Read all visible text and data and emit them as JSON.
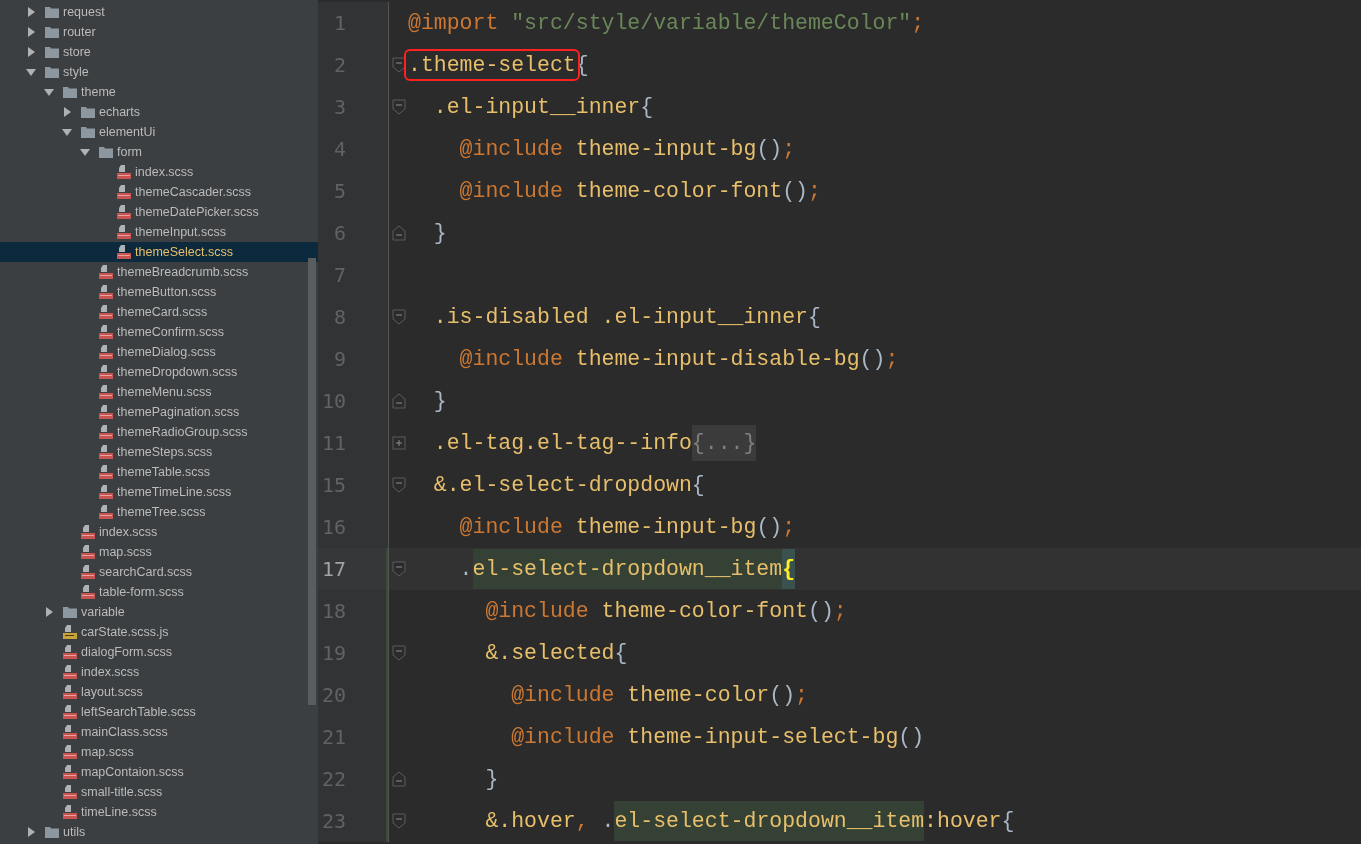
{
  "project_tree": [
    {
      "name": "request",
      "kind": "folder",
      "expanded": false,
      "selected": false
    },
    {
      "name": "router",
      "kind": "folder",
      "expanded": false,
      "selected": false
    },
    {
      "name": "store",
      "kind": "folder",
      "expanded": false,
      "selected": false
    },
    {
      "name": "style",
      "kind": "folder",
      "expanded": true,
      "selected": false,
      "children": [
        {
          "name": "theme",
          "kind": "folder",
          "expanded": true,
          "selected": false,
          "children": [
            {
              "name": "echarts",
              "kind": "folder",
              "expanded": false,
              "selected": false
            },
            {
              "name": "elementUi",
              "kind": "folder",
              "expanded": true,
              "selected": false,
              "children": [
                {
                  "name": "form",
                  "kind": "folder",
                  "expanded": true,
                  "selected": false,
                  "children": [
                    {
                      "name": "index.scss",
                      "kind": "sass",
                      "selected": false
                    },
                    {
                      "name": "themeCascader.scss",
                      "kind": "sass",
                      "selected": false
                    },
                    {
                      "name": "themeDatePicker.scss",
                      "kind": "sass",
                      "selected": false
                    },
                    {
                      "name": "themeInput.scss",
                      "kind": "sass",
                      "selected": false
                    },
                    {
                      "name": "themeSelect.scss",
                      "kind": "sass",
                      "selected": true
                    }
                  ]
                },
                {
                  "name": "themeBreadcrumb.scss",
                  "kind": "sass",
                  "selected": false
                },
                {
                  "name": "themeButton.scss",
                  "kind": "sass",
                  "selected": false
                },
                {
                  "name": "themeCard.scss",
                  "kind": "sass",
                  "selected": false
                },
                {
                  "name": "themeConfirm.scss",
                  "kind": "sass",
                  "selected": false
                },
                {
                  "name": "themeDialog.scss",
                  "kind": "sass",
                  "selected": false
                },
                {
                  "name": "themeDropdown.scss",
                  "kind": "sass",
                  "selected": false
                },
                {
                  "name": "themeMenu.scss",
                  "kind": "sass",
                  "selected": false
                },
                {
                  "name": "themePagination.scss",
                  "kind": "sass",
                  "selected": false
                },
                {
                  "name": "themeRadioGroup.scss",
                  "kind": "sass",
                  "selected": false
                },
                {
                  "name": "themeSteps.scss",
                  "kind": "sass",
                  "selected": false
                },
                {
                  "name": "themeTable.scss",
                  "kind": "sass",
                  "selected": false
                },
                {
                  "name": "themeTimeLine.scss",
                  "kind": "sass",
                  "selected": false
                },
                {
                  "name": "themeTree.scss",
                  "kind": "sass",
                  "selected": false
                }
              ]
            },
            {
              "name": "index.scss",
              "kind": "sass",
              "selected": false
            },
            {
              "name": "map.scss",
              "kind": "sass",
              "selected": false
            },
            {
              "name": "searchCard.scss",
              "kind": "sass",
              "selected": false
            },
            {
              "name": "table-form.scss",
              "kind": "sass",
              "selected": false
            }
          ]
        },
        {
          "name": "variable",
          "kind": "folder",
          "expanded": false,
          "selected": false
        },
        {
          "name": "carState.scss.js",
          "kind": "js",
          "selected": false
        },
        {
          "name": "dialogForm.scss",
          "kind": "sass",
          "selected": false
        },
        {
          "name": "index.scss",
          "kind": "sass",
          "selected": false
        },
        {
          "name": "layout.scss",
          "kind": "sass",
          "selected": false
        },
        {
          "name": "leftSearchTable.scss",
          "kind": "sass",
          "selected": false
        },
        {
          "name": "mainClass.scss",
          "kind": "sass",
          "selected": false
        },
        {
          "name": "map.scss",
          "kind": "sass",
          "selected": false
        },
        {
          "name": "mapContaion.scss",
          "kind": "sass",
          "selected": false
        },
        {
          "name": "small-title.scss",
          "kind": "sass",
          "selected": false
        },
        {
          "name": "timeLine.scss",
          "kind": "sass",
          "selected": false
        }
      ]
    },
    {
      "name": "utils",
      "kind": "folder",
      "expanded": false,
      "selected": false
    }
  ],
  "editor": {
    "lines": [
      {
        "number": "1",
        "kind": "plain",
        "current": false,
        "modified": false,
        "tokens": [
          {
            "text": "@import ",
            "kind": "keyword"
          },
          {
            "text": "\"src/style/variable/themeColor\"",
            "kind": "string"
          },
          {
            "text": ";",
            "kind": "semicolon"
          }
        ]
      },
      {
        "number": "2",
        "kind": "fold-start",
        "current": false,
        "modified": false,
        "tokens": [
          {
            "text": ".theme-select",
            "kind": "selector",
            "boxed": true
          },
          {
            "text": "{",
            "kind": "punct"
          }
        ]
      },
      {
        "number": "3",
        "kind": "fold-start",
        "current": false,
        "modified": false,
        "tokens": [
          {
            "text": "  .el-input__inner",
            "kind": "selector"
          },
          {
            "text": "{",
            "kind": "punct"
          }
        ]
      },
      {
        "number": "4",
        "kind": "plain",
        "current": false,
        "modified": false,
        "tokens": [
          {
            "text": "    @include ",
            "kind": "keyword"
          },
          {
            "text": "theme-input-bg",
            "kind": "function"
          },
          {
            "text": "()",
            "kind": "punct"
          },
          {
            "text": ";",
            "kind": "semicolon"
          }
        ]
      },
      {
        "number": "5",
        "kind": "plain",
        "current": false,
        "modified": false,
        "tokens": [
          {
            "text": "    @include ",
            "kind": "keyword"
          },
          {
            "text": "theme-color-font",
            "kind": "function"
          },
          {
            "text": "()",
            "kind": "punct"
          },
          {
            "text": ";",
            "kind": "semicolon"
          }
        ]
      },
      {
        "number": "6",
        "kind": "fold-end",
        "current": false,
        "modified": false,
        "tokens": [
          {
            "text": "  }",
            "kind": "punct"
          }
        ]
      },
      {
        "number": "7",
        "kind": "plain",
        "current": false,
        "modified": false
      },
      {
        "number": "8",
        "kind": "fold-start",
        "current": false,
        "modified": false,
        "tokens": [
          {
            "text": "  .is-disabled .el-input__inner",
            "kind": "selector"
          },
          {
            "text": "{",
            "kind": "punct"
          }
        ]
      },
      {
        "number": "9",
        "kind": "plain",
        "current": false,
        "modified": false,
        "tokens": [
          {
            "text": "    @include ",
            "kind": "keyword"
          },
          {
            "text": "theme-input-disable-bg",
            "kind": "function"
          },
          {
            "text": "()",
            "kind": "punct"
          },
          {
            "text": ";",
            "kind": "semicolon"
          }
        ]
      },
      {
        "number": "10",
        "kind": "fold-end",
        "current": false,
        "modified": false,
        "tokens": [
          {
            "text": "  }",
            "kind": "punct"
          }
        ]
      },
      {
        "number": "11",
        "kind": "folded",
        "current": false,
        "modified": false,
        "tokens": [
          {
            "text": "  .el-tag.el-tag--info",
            "kind": "selector"
          },
          {
            "text": "{...}",
            "kind": "folded"
          }
        ]
      },
      {
        "number": "15",
        "kind": "fold-start",
        "current": false,
        "modified": false,
        "tokens": [
          {
            "text": "  &.el-select-dropdown",
            "kind": "selector"
          },
          {
            "text": "{",
            "kind": "punct"
          }
        ]
      },
      {
        "number": "16",
        "kind": "plain",
        "current": false,
        "modified": false,
        "tokens": [
          {
            "text": "    @include ",
            "kind": "keyword"
          },
          {
            "text": "theme-input-bg",
            "kind": "function"
          },
          {
            "text": "()",
            "kind": "punct"
          },
          {
            "text": ";",
            "kind": "semicolon"
          }
        ]
      },
      {
        "number": "17",
        "kind": "fold-start",
        "current": true,
        "modified": true,
        "tokens": [
          {
            "text": "    .",
            "kind": "punct"
          },
          {
            "text": "el-select-dropdown__item",
            "kind": "selector",
            "highlighted": true
          },
          {
            "text": "{",
            "kind": "brace-match"
          }
        ]
      },
      {
        "number": "18",
        "kind": "plain",
        "current": false,
        "modified": true,
        "tokens": [
          {
            "text": "      @include ",
            "kind": "keyword"
          },
          {
            "text": "theme-color-font",
            "kind": "function"
          },
          {
            "text": "()",
            "kind": "punct"
          },
          {
            "text": ";",
            "kind": "semicolon"
          }
        ]
      },
      {
        "number": "19",
        "kind": "fold-start",
        "current": false,
        "modified": true,
        "tokens": [
          {
            "text": "      &.selected",
            "kind": "selector"
          },
          {
            "text": "{",
            "kind": "punct"
          }
        ]
      },
      {
        "number": "20",
        "kind": "plain",
        "current": false,
        "modified": true,
        "tokens": [
          {
            "text": "        @include ",
            "kind": "keyword"
          },
          {
            "text": "theme-color",
            "kind": "function"
          },
          {
            "text": "()",
            "kind": "punct"
          },
          {
            "text": ";",
            "kind": "semicolon"
          }
        ]
      },
      {
        "number": "21",
        "kind": "plain",
        "current": false,
        "modified": true,
        "tokens": [
          {
            "text": "        @include ",
            "kind": "keyword"
          },
          {
            "text": "theme-input-select-bg",
            "kind": "function"
          },
          {
            "text": "()",
            "kind": "punct"
          }
        ]
      },
      {
        "number": "22",
        "kind": "fold-end",
        "current": false,
        "modified": true,
        "tokens": [
          {
            "text": "      }",
            "kind": "punct"
          }
        ]
      },
      {
        "number": "23",
        "kind": "fold-start",
        "current": false,
        "modified": true,
        "tokens": [
          {
            "text": "      &.hover",
            "kind": "selector"
          },
          {
            "text": ", ",
            "kind": "semicolon"
          },
          {
            "text": ".",
            "kind": "punct"
          },
          {
            "text": "el-select-dropdown__item",
            "kind": "selector",
            "highlighted": true
          },
          {
            "text": ":hover",
            "kind": "selector"
          },
          {
            "text": "{",
            "kind": "punct"
          }
        ]
      }
    ]
  }
}
